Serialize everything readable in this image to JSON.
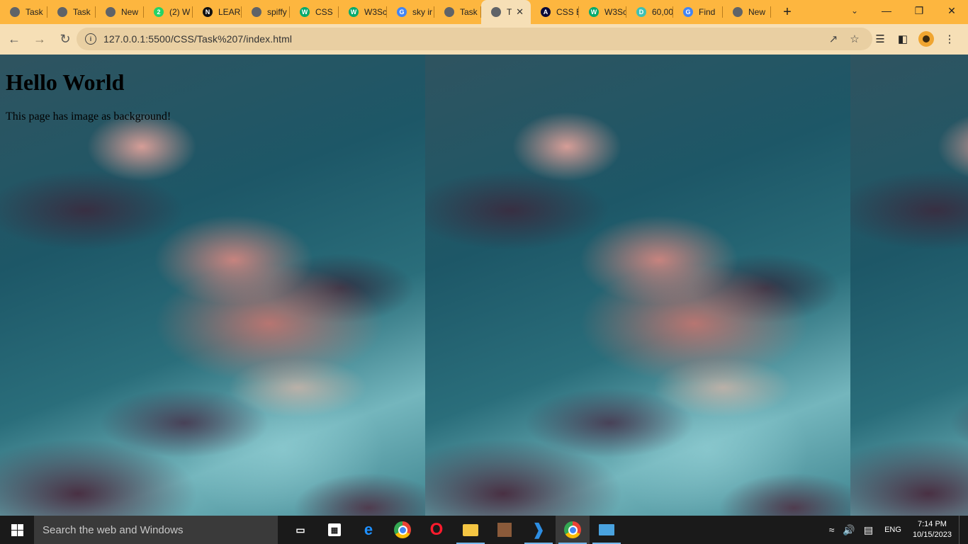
{
  "tabs": [
    {
      "label": "Task",
      "favicon": "globe-icon",
      "color": "#5f6368"
    },
    {
      "label": "Task",
      "favicon": "globe-icon",
      "color": "#5f6368"
    },
    {
      "label": "New",
      "favicon": "chrome-icon",
      "color": "#5f6368"
    },
    {
      "label": "(2) W",
      "favicon": "whatsapp-icon",
      "color": "#25d366",
      "glyph": "2"
    },
    {
      "label": "LEAR",
      "favicon": "notion-icon",
      "color": "#111111",
      "glyph": "N"
    },
    {
      "label": "spiffy",
      "favicon": "globe-icon",
      "color": "#5f6368"
    },
    {
      "label": "CSS",
      "favicon": "w3schools-icon",
      "color": "#04aa6d",
      "glyph": "W"
    },
    {
      "label": "W3Sc",
      "favicon": "w3schools-icon",
      "color": "#04aa6d",
      "glyph": "W"
    },
    {
      "label": "sky ir",
      "favicon": "google-icon",
      "color": "#4285f4",
      "glyph": "G"
    },
    {
      "label": "Task",
      "favicon": "globe-icon",
      "color": "#5f6368"
    },
    {
      "label": "T",
      "favicon": "globe-icon",
      "color": "#5f6368",
      "active": true
    },
    {
      "label": "CSS E",
      "favicon": "codepen-icon",
      "color": "#0a0a3a",
      "glyph": "A"
    },
    {
      "label": "W3Sc",
      "favicon": "w3schools-icon",
      "color": "#04aa6d",
      "glyph": "W"
    },
    {
      "label": "60,00",
      "favicon": "d-icon",
      "color": "#3ec1b4",
      "glyph": "D"
    },
    {
      "label": "Find",
      "favicon": "google-icon",
      "color": "#4285f4",
      "glyph": "G"
    },
    {
      "label": "New",
      "favicon": "chrome-icon",
      "color": "#5f6368"
    }
  ],
  "omnibox": {
    "url": "127.0.0.1:5500/CSS/Task%207/index.html"
  },
  "page": {
    "heading": "Hello World",
    "paragraph": "This page has image as background!"
  },
  "taskbar": {
    "search_placeholder": "Search the web and Windows",
    "language": "ENG",
    "time": "7:14 PM",
    "date": "10/15/2023"
  }
}
